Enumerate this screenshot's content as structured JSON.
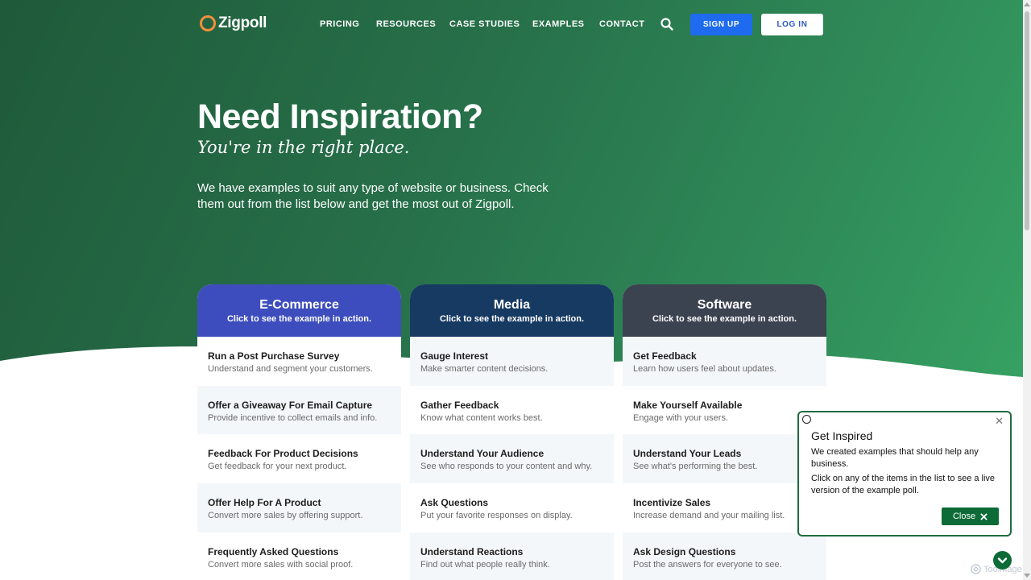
{
  "header": {
    "logo_text": "Zigpoll",
    "nav": [
      "PRICING",
      "RESOURCES",
      "CASE STUDIES",
      "EXAMPLES",
      "CONTACT"
    ],
    "signup_label": "SIGN UP",
    "login_label": "LOG IN"
  },
  "hero": {
    "title": "Need Inspiration?",
    "subtitle": "You're in the right place.",
    "description": "We have examples to suit any type of website or business. Check them out from the list below and get the most out of Zigpoll."
  },
  "cards": [
    {
      "title": "E-Commerce",
      "subtitle": "Click to see the example in action.",
      "color": "#3d4dbd",
      "items": [
        {
          "name": "Run a Post Purchase Survey",
          "desc": "Understand and segment your customers."
        },
        {
          "name": "Offer a Giveaway For Email Capture",
          "desc": "Provide incentive to collect emails and info."
        },
        {
          "name": "Feedback For Product Decisions",
          "desc": "Get feedback for your next product."
        },
        {
          "name": "Offer Help For A Product",
          "desc": "Convert more sales by offering support."
        },
        {
          "name": "Frequently Asked Questions",
          "desc": "Convert more sales with social proof."
        }
      ]
    },
    {
      "title": "Media",
      "subtitle": "Click to see the example in action.",
      "color": "#173a63",
      "items": [
        {
          "name": "Gauge Interest",
          "desc": "Make smarter content decisions."
        },
        {
          "name": "Gather Feedback",
          "desc": "Know what content works best."
        },
        {
          "name": "Understand Your Audience",
          "desc": "See who responds to your content and why."
        },
        {
          "name": "Ask Questions",
          "desc": "Put your favorite responses on display."
        },
        {
          "name": "Understand Reactions",
          "desc": "Find out what people really think."
        }
      ]
    },
    {
      "title": "Software",
      "subtitle": "Click to see the example in action.",
      "color": "#3b4250",
      "items": [
        {
          "name": "Get Feedback",
          "desc": "Learn how users feel about updates."
        },
        {
          "name": "Make Yourself Available",
          "desc": "Engage with your users."
        },
        {
          "name": "Understand Your Leads",
          "desc": "See what's performing the best."
        },
        {
          "name": "Incentivize Sales",
          "desc": "Increase demand and your mailing list."
        },
        {
          "name": "Ask Design Questions",
          "desc": "Post the answers for everyone to see."
        }
      ]
    }
  ],
  "popup": {
    "title": "Get Inspired",
    "line1": "We created examples that should help any business.",
    "line2": "Click on any of the items in the list to see a live version of the example poll.",
    "close_label": "Close"
  },
  "watermark": "ToolMage"
}
